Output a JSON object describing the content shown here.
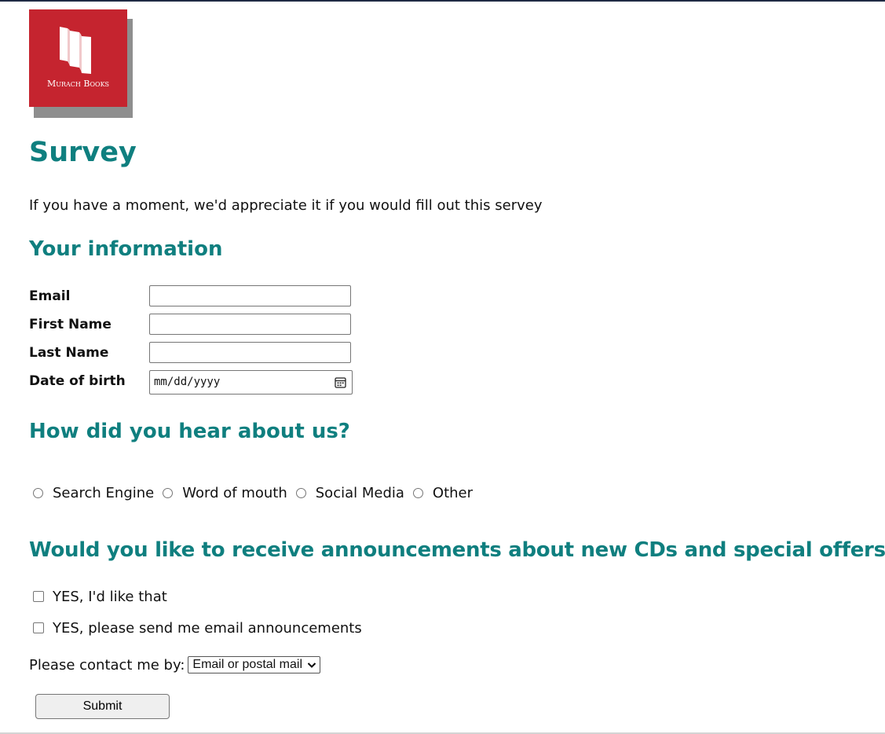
{
  "logo": {
    "brand_text": "Murach Books",
    "background_color": "#c5242f",
    "shadow_color": "#8e8e8e"
  },
  "page": {
    "title": "Survey",
    "intro": "If you have a moment, we'd appreciate it if you would fill out this servey",
    "accent_color": "#0f7f7f"
  },
  "info_section": {
    "heading": "Your information",
    "fields": {
      "email": {
        "label": "Email",
        "value": ""
      },
      "first_name": {
        "label": "First Name",
        "value": ""
      },
      "last_name": {
        "label": "Last Name",
        "value": ""
      },
      "dob": {
        "label": "Date of birth",
        "placeholder": "mm/dd/yyyy",
        "icon": "calendar-icon"
      }
    }
  },
  "hear_section": {
    "heading": "How did you hear about us?",
    "options": [
      "Search Engine",
      "Word of mouth",
      "Social Media",
      "Other"
    ]
  },
  "announce_section": {
    "heading": "Would you like to receive announcements about new CDs and special offers?",
    "checkboxes": [
      "YES, I'd like that",
      "YES, please send me email announcements"
    ],
    "contact_label": "Please contact me by:",
    "contact_selected": "Email or postal mail"
  },
  "submit_label": "Submit"
}
